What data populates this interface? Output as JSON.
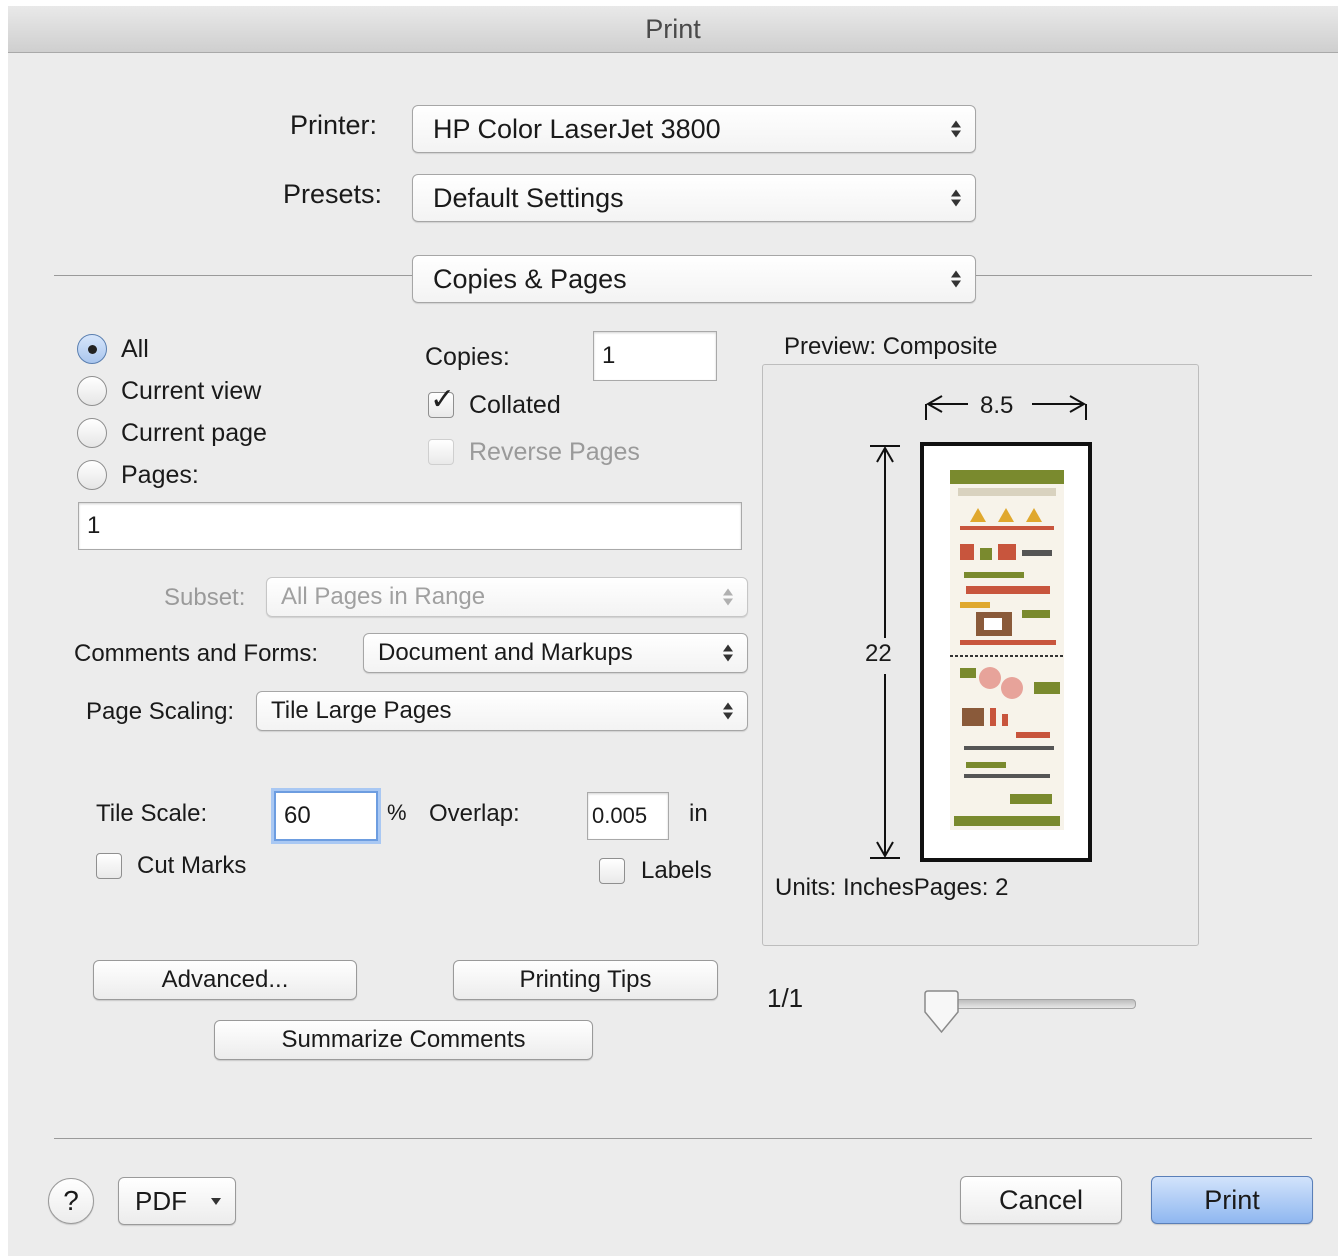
{
  "window": {
    "title": "Print"
  },
  "printer": {
    "label": "Printer:",
    "value": "HP Color LaserJet 3800"
  },
  "presets": {
    "label": "Presets:",
    "value": "Default Settings"
  },
  "section": {
    "value": "Copies & Pages"
  },
  "range": {
    "options": [
      "All",
      "Current view",
      "Current page",
      "Pages:"
    ],
    "selected": "All",
    "pages_value": "1"
  },
  "copies": {
    "label": "Copies:",
    "value": "1",
    "collated_label": "Collated",
    "collated_checked": true,
    "reverse_label": "Reverse Pages",
    "reverse_enabled": false
  },
  "subset": {
    "label": "Subset:",
    "value": "All Pages in Range",
    "enabled": false
  },
  "comments": {
    "label": "Comments and Forms:",
    "value": "Document and Markups"
  },
  "scaling": {
    "label": "Page Scaling:",
    "value": "Tile Large Pages"
  },
  "tile": {
    "scale_label": "Tile Scale:",
    "scale_value": "60",
    "percent": "%",
    "overlap_label": "Overlap:",
    "overlap_value": "0.005",
    "overlap_unit": "in",
    "cut_marks_label": "Cut Marks",
    "labels_label": "Labels"
  },
  "buttons": {
    "advanced": "Advanced...",
    "tips": "Printing Tips",
    "summarize": "Summarize Comments"
  },
  "preview": {
    "title": "Preview: Composite",
    "width": "8.5",
    "height": "22",
    "units": "Units: Inches",
    "pages": "Pages: 2",
    "page_indicator": "1/1",
    "slider_position": 0
  },
  "footer": {
    "help": "?",
    "pdf": "PDF",
    "cancel": "Cancel",
    "print": "Print"
  }
}
